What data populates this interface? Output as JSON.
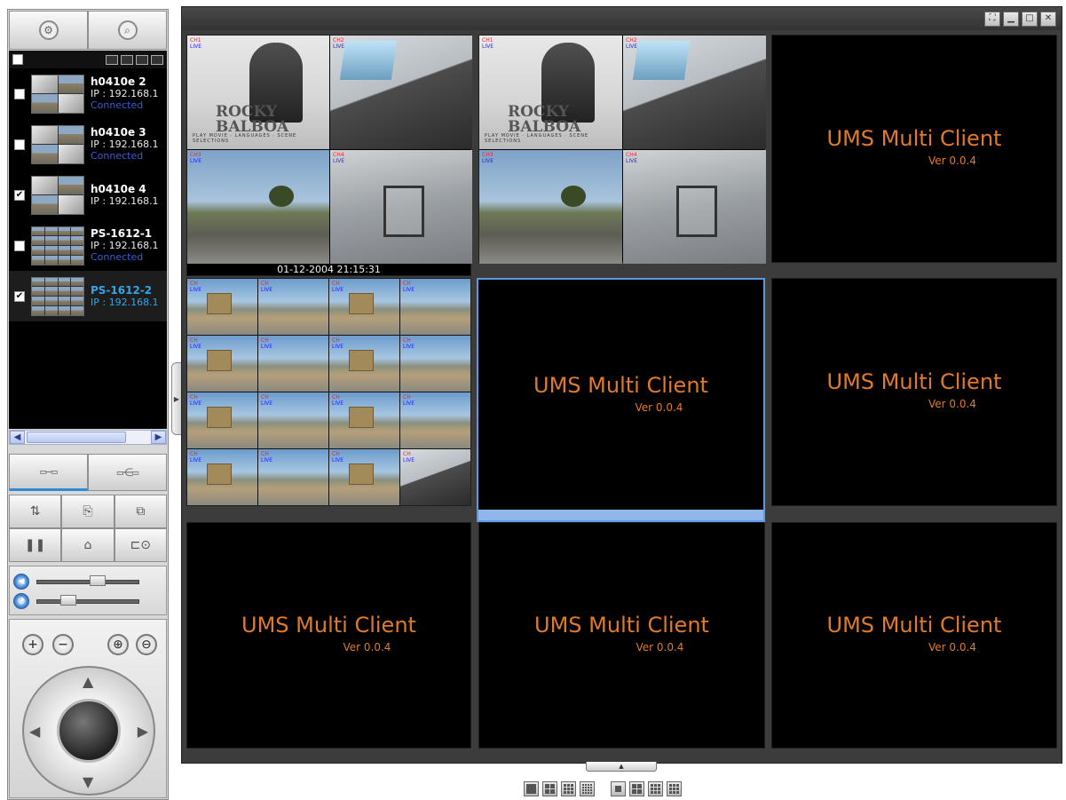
{
  "left_panel": {
    "devices": [
      {
        "name": "h0410e 2",
        "ip": "IP : 192.168.1",
        "status": "Connected",
        "checked": false
      },
      {
        "name": "h0410e 3",
        "ip": "IP : 192.168.1",
        "status": "Connected",
        "checked": false
      },
      {
        "name": "h0410e 4",
        "ip": "IP : 192.168.1",
        "status": "",
        "checked": true
      },
      {
        "name": "PS-1612-1",
        "ip": "IP : 192.168.1",
        "status": "Connected",
        "checked": false
      },
      {
        "name": "PS-1612-2",
        "ip": "IP : 192.168.1",
        "status": "",
        "checked": true
      }
    ],
    "icons": {
      "settings": "gear-icon",
      "search": "search-icon",
      "volume": "speaker-icon",
      "speed": "speed-icon"
    },
    "sliders": {
      "volume_level": 0.6,
      "speed_level": 0.27
    }
  },
  "viewer": {
    "timestamp": "01-12-2004 21:15:31",
    "placeholder_title": "UMS Multi Client",
    "placeholder_version": "Ver 0.0.4",
    "selected_cell": 4,
    "colors": {
      "placeholder_text": "#e07a28",
      "selection": "#8fb7ec"
    }
  }
}
